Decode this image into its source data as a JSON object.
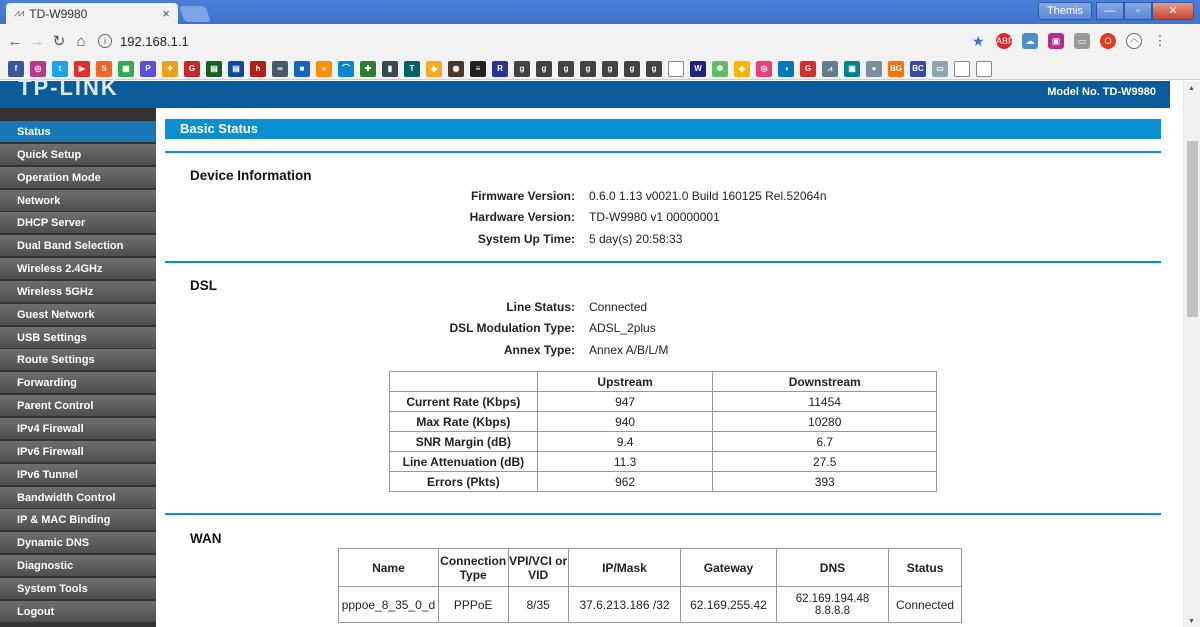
{
  "browser": {
    "tab_title": "TD-W9980",
    "tab_close": "×",
    "url": "192.168.1.1",
    "profile": "Themis"
  },
  "router": {
    "logo": "TP-LINK",
    "model": "Model No. TD-W9980"
  },
  "sidebar": {
    "items": [
      "Status",
      "Quick Setup",
      "Operation Mode",
      "Network",
      "DHCP Server",
      "Dual Band Selection",
      "Wireless 2.4GHz",
      "Wireless 5GHz",
      "Guest Network",
      "USB Settings",
      "Route Settings",
      "Forwarding",
      "Parent Control",
      "IPv4 Firewall",
      "IPv6 Firewall",
      "IPv6 Tunnel",
      "Bandwidth Control",
      "IP & MAC Binding",
      "Dynamic DNS",
      "Diagnostic",
      "System Tools",
      "Logout"
    ],
    "active": "Status"
  },
  "main": {
    "banner": "Basic Status",
    "device": {
      "title": "Device Information",
      "firmware_label": "Firmware Version:",
      "firmware": "0.6.0 1.13 v0021.0 Build 160125 Rel.52064n",
      "hardware_label": "Hardware Version:",
      "hardware": "TD-W9980 v1 00000001",
      "uptime_label": "System Up Time:",
      "uptime": "5 day(s) 20:58:33"
    },
    "dsl": {
      "title": "DSL",
      "line_status_label": "Line Status:",
      "line_status": "Connected",
      "modulation_label": "DSL Modulation Type:",
      "modulation": "ADSL_2plus",
      "annex_label": "Annex Type:",
      "annex": "Annex A/B/L/M",
      "headers": [
        "",
        "Upstream",
        "Downstream"
      ],
      "rows": [
        [
          "Current Rate (Kbps)",
          "947",
          "11454"
        ],
        [
          "Max Rate (Kbps)",
          "940",
          "10280"
        ],
        [
          "SNR Margin (dB)",
          "9.4",
          "6.7"
        ],
        [
          "Line Attenuation (dB)",
          "11.3",
          "27.5"
        ],
        [
          "Errors (Pkts)",
          "962",
          "393"
        ]
      ]
    },
    "wan": {
      "title": "WAN",
      "headers": [
        "Name",
        "Connection Type",
        "VPI/VCI or VID",
        "IP/Mask",
        "Gateway",
        "DNS",
        "Status"
      ],
      "rows": [
        [
          "pppoe_8_35_0_d",
          "PPPoE",
          "8/35",
          "37.6.213.186 /32",
          "62.169.255.42",
          "62.169.194.48 8.8.8.8",
          "Connected"
        ]
      ]
    }
  }
}
